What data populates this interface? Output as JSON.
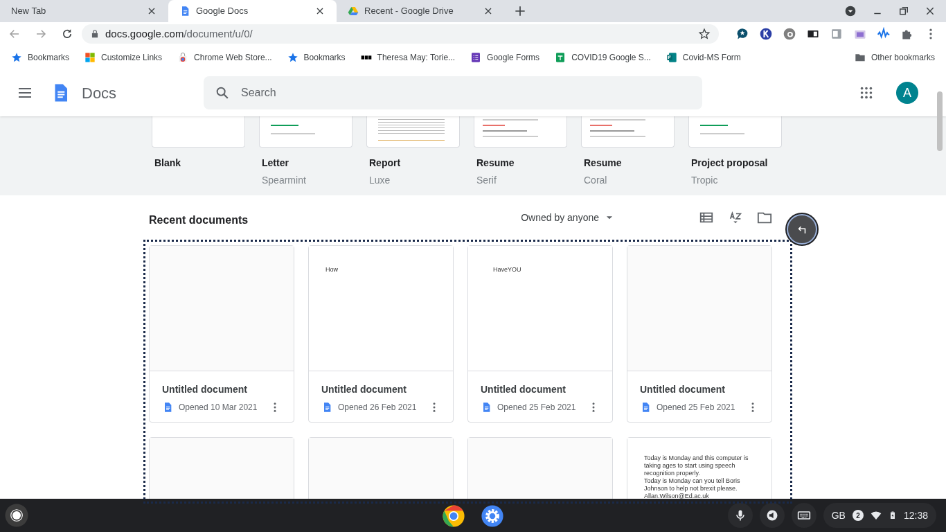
{
  "tabs": [
    {
      "title": "New Tab",
      "kind": "plain",
      "selected": false
    },
    {
      "title": "Google Docs",
      "kind": "docs",
      "selected": true
    },
    {
      "title": "Recent - Google Drive",
      "kind": "drive",
      "selected": false
    }
  ],
  "address": {
    "host": "docs.google.com",
    "path": "/document/u/0/"
  },
  "bookmarks": [
    {
      "label": "Bookmarks"
    },
    {
      "label": "Customize Links"
    },
    {
      "label": "Chrome Web Store..."
    },
    {
      "label": "Bookmarks"
    },
    {
      "label": "Theresa May: Torie..."
    },
    {
      "label": "Google Forms"
    },
    {
      "label": "COVID19 Google S..."
    },
    {
      "label": "Covid-MS Form"
    }
  ],
  "other_bookmarks": "Other bookmarks",
  "app": {
    "name": "Docs",
    "search_placeholder": "Search",
    "avatar": "A"
  },
  "templates": [
    {
      "name": "Blank"
    },
    {
      "name": "Letter",
      "style": "Spearmint"
    },
    {
      "name": "Report",
      "style": "Luxe"
    },
    {
      "name": "Resume",
      "style": "Serif"
    },
    {
      "name": "Resume",
      "style": "Coral"
    },
    {
      "name": "Project proposal",
      "style": "Tropic"
    }
  ],
  "recent": {
    "title": "Recent documents",
    "filter": "Owned by anyone",
    "documents": [
      {
        "title": "Untitled document",
        "opened": "Opened 10 Mar 2021"
      },
      {
        "title": "Untitled document",
        "opened": "Opened 26 Feb 2021",
        "preview": [
          "How"
        ]
      },
      {
        "title": "Untitled document",
        "opened": "Opened 25 Feb 2021",
        "preview": [
          "HaveYOU"
        ]
      },
      {
        "title": "Untitled document",
        "opened": "Opened 25 Feb 2021"
      },
      {
        "kind": "empty"
      },
      {
        "kind": "empty"
      },
      {
        "kind": "empty"
      },
      {
        "kind": "text",
        "preview": [
          "Today is Monday and this computer is taking ages to start using speech recognition properly.",
          "Today is Monday can you tell Boris Johnson to help not brexit please.",
          "Allan.Wilson@Ed.ac.uk"
        ]
      }
    ]
  },
  "taskbar": {
    "keyboard_layout": "GB",
    "notifications": "2",
    "time": "12:38"
  }
}
